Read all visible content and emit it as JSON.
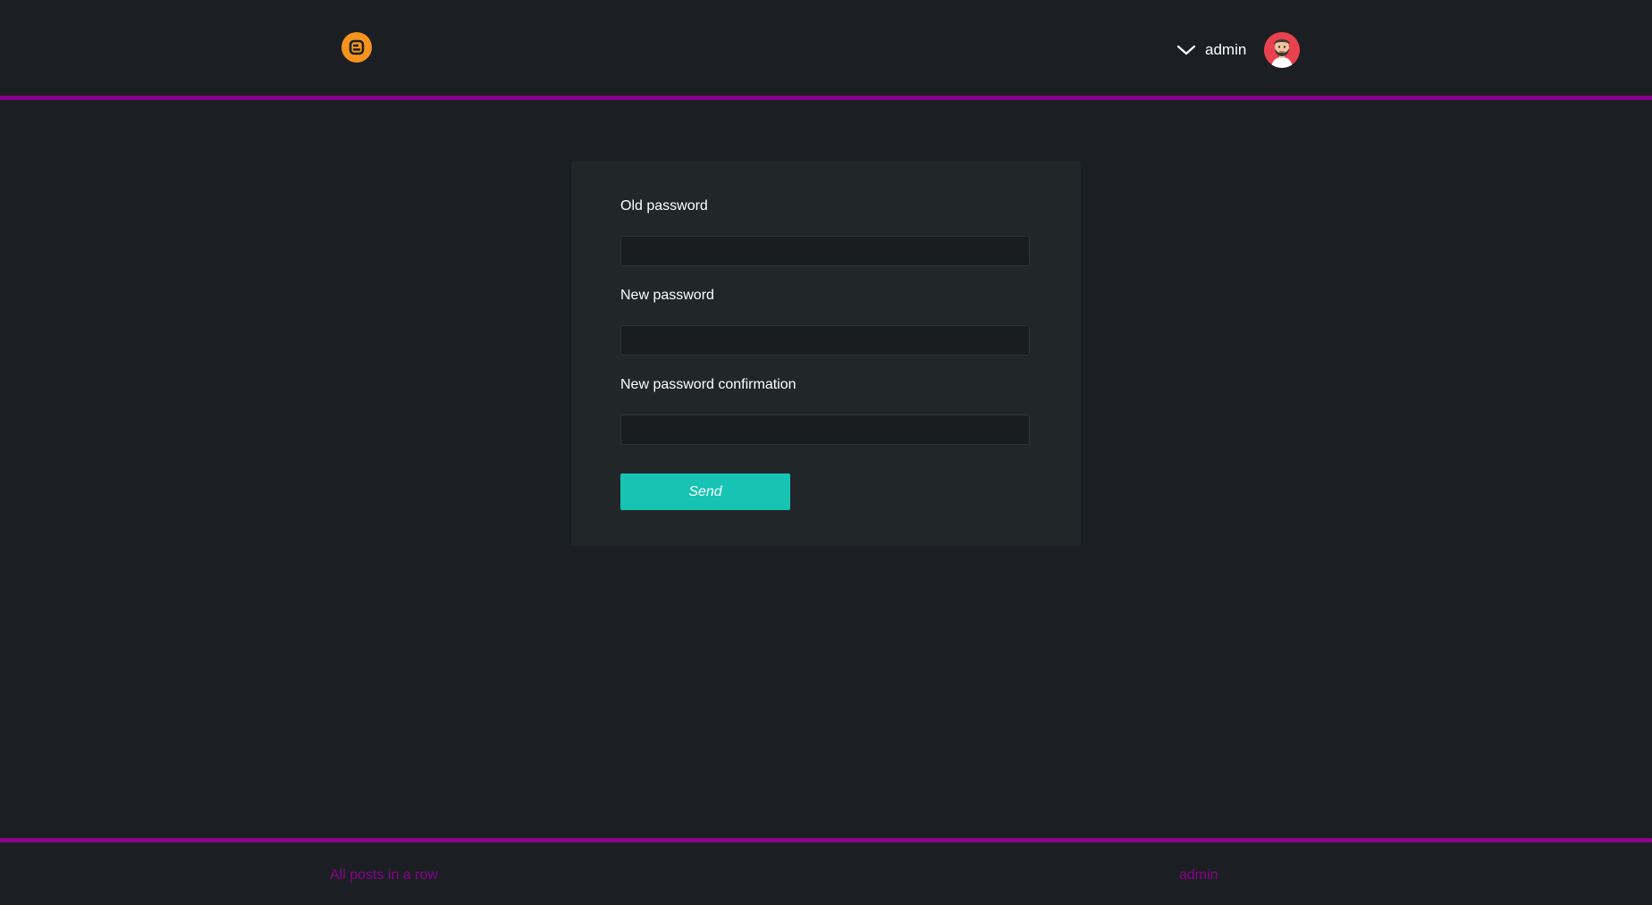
{
  "colors": {
    "background": "#1b1f23",
    "card": "#212629",
    "accent_line": "#8a008a",
    "button": "#17c3b2",
    "logo": "#f7941d",
    "footer_link": "#8a008a"
  },
  "header": {
    "logo_icon": "blogger-logo-icon",
    "user_menu": {
      "chevron_icon": "chevron-down-icon",
      "username": "admin",
      "avatar_icon": "bearded-man-avatar"
    }
  },
  "form": {
    "old_password": {
      "label": "Old password",
      "value": ""
    },
    "new_password": {
      "label": "New password",
      "value": ""
    },
    "new_password_confirmation": {
      "label": "New password confirmation",
      "value": ""
    },
    "submit_label": "Send"
  },
  "footer": {
    "left_link": "All posts in a row",
    "right_link": "admin"
  }
}
